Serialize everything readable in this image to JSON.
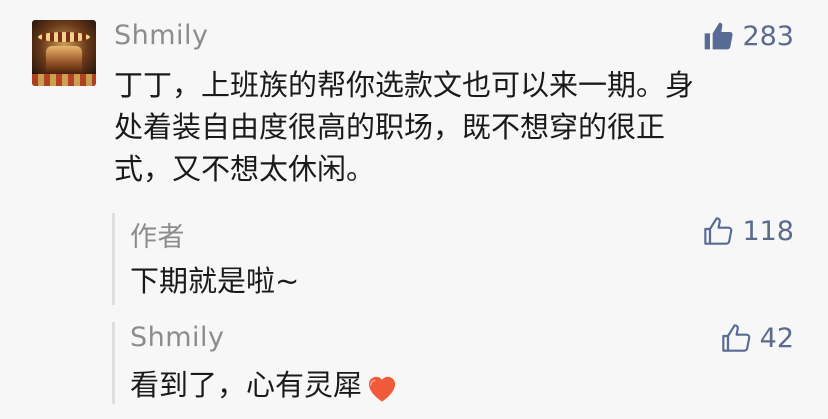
{
  "comment": {
    "user": "Shmily",
    "likes": "283",
    "lines": [
      "丁丁，上班族的帮你选款文也可以来一期。身",
      "处着装自由度很高的职场，既不想穿的很正",
      "式，又不想太休闲。"
    ]
  },
  "replies": [
    {
      "user": "作者",
      "likes": "118",
      "text": "下期就是啦~"
    },
    {
      "user": "Shmily",
      "likes": "42",
      "text": "看到了，心有灵犀"
    }
  ],
  "colors": {
    "like_filled": "#576b95",
    "heart": "#f05a3a"
  },
  "icons": [
    "thumbs-up-filled-icon",
    "thumbs-up-outline-icon",
    "heart-emoji-icon"
  ]
}
